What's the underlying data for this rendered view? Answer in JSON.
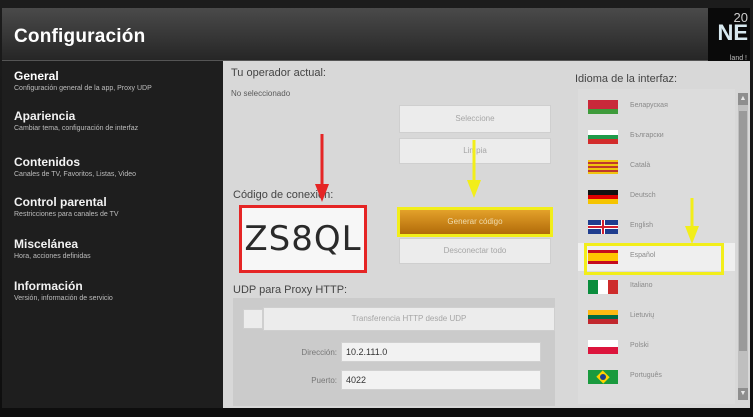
{
  "window": {
    "title": "Configuración"
  },
  "badge": {
    "year": "20",
    "word": "NE",
    "sub": "land !"
  },
  "sidebar": {
    "items": [
      {
        "label": "General",
        "sub": "Configuración general de la app, Proxy UDP",
        "active": true
      },
      {
        "label": "Apariencia",
        "sub": "Cambiar tema, configuración de interfaz"
      },
      {
        "label": "Contenidos",
        "sub": "Canales de TV, Favoritos, Listas, Video"
      },
      {
        "label": "Control parental",
        "sub": "Restricciones para canales de TV"
      },
      {
        "label": "Miscelánea",
        "sub": "Hora, acciones definidas"
      },
      {
        "label": "Información",
        "sub": "Versión, información de servicio"
      }
    ]
  },
  "operator": {
    "title": "Tu operador actual:",
    "value": "No seleccionado",
    "select_label": "Seleccione",
    "clear_label": "Limpia"
  },
  "connection": {
    "title": "Código de conexión:",
    "code": "ZS8QL",
    "generate_label": "Generar código",
    "disconnect_label": "Desconectar todo"
  },
  "udp": {
    "title": "UDP para Proxy HTTP:",
    "toggle_label": "Transferencia HTTP desde UDP",
    "address_label": "Dirección:",
    "address_value": "10.2.111.0",
    "port_label": "Puerto:",
    "port_value": "4022"
  },
  "language": {
    "title": "Idioma de la interfaz:",
    "items": [
      {
        "name": "Беларуская",
        "flag": "by"
      },
      {
        "name": "Български",
        "flag": "bg"
      },
      {
        "name": "Català",
        "flag": "ca"
      },
      {
        "name": "Deutsch",
        "flag": "de"
      },
      {
        "name": "English",
        "flag": "gb"
      },
      {
        "name": "Español",
        "flag": "es",
        "selected": true
      },
      {
        "name": "Italiano",
        "flag": "it"
      },
      {
        "name": "Lietuvių",
        "flag": "lt"
      },
      {
        "name": "Polski",
        "flag": "pl"
      },
      {
        "name": "Português",
        "flag": "br"
      }
    ]
  },
  "colors": {
    "highlight_red": "#e52525",
    "highlight_yellow": "#f2ee1a",
    "accent_gold": "#d48a18"
  }
}
